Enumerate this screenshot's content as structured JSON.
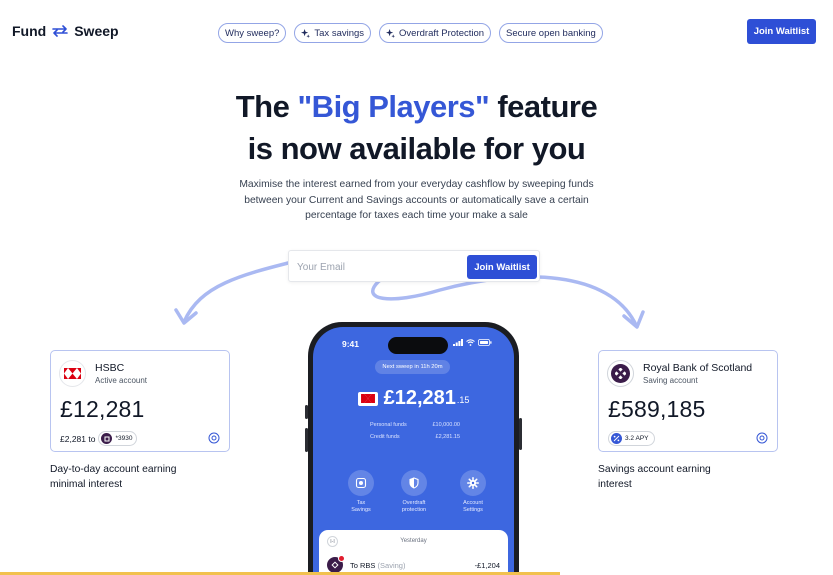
{
  "header": {
    "logo_left": "Fund",
    "logo_right": "Sweep",
    "nav": [
      {
        "label": "Why sweep?",
        "icon": ""
      },
      {
        "label": "Tax savings",
        "icon": "sparkle-icon"
      },
      {
        "label": "Overdraft Protection",
        "icon": "sparkle-icon"
      },
      {
        "label": "Secure open banking",
        "icon": ""
      }
    ],
    "cta": "Join Waitlist"
  },
  "hero": {
    "title_pre": "The ",
    "title_accent": "\"Big Players\"",
    "title_post": " feature",
    "title_line2": "is now available for you",
    "subtitle": "Maximise the interest earned from your everyday cashflow by sweeping funds between your Current and Savings accounts or automatically save a certain percentage for taxes each time your make a sale"
  },
  "signup": {
    "placeholder": "Your Email",
    "button": "Join Waitlist"
  },
  "left_card": {
    "bank": "HSBC",
    "status": "Active account",
    "balance": "£12,281",
    "transfer_amount": "£2,281 to",
    "target_account": "*3930",
    "caption_line1": "Day-to-day account earning",
    "caption_line2": "minimal interest"
  },
  "right_card": {
    "bank": "Royal Bank of Scotland",
    "status": "Saving account",
    "balance": "£589,185",
    "apy": "3.2 APY",
    "caption_line1": "Savings account earning",
    "caption_line2": "interest"
  },
  "phone": {
    "time": "9:41",
    "next_sweep": "Next sweep in 11h 20m",
    "balance": "£12,281",
    "balance_cents": ".15",
    "personal_label": "Personal funds",
    "personal_value": "£10,000.00",
    "credit_label": "Credit funds",
    "credit_value": "£2,281.15",
    "actions": [
      {
        "line1": "Tax",
        "line2": "Savings",
        "icon": "tax-savings-icon"
      },
      {
        "line1": "Overdraft",
        "line2": "protection",
        "icon": "shield-icon"
      },
      {
        "line1": "Account",
        "line2": "Settings",
        "icon": "gear-icon"
      }
    ],
    "history_toggle": "I-I",
    "history_heading": "Yesterday",
    "tx_label": "To RBS",
    "tx_note": "(Saving)",
    "tx_amount": "-£1,204"
  },
  "colors": {
    "brand_blue": "#2e4fd6",
    "accent_text": "#3557d6",
    "phone_screen": "#3d67e0",
    "arrow": "#aab9f2",
    "hsbc_red": "#db0011",
    "rbs_purple": "#3b1c4a"
  }
}
